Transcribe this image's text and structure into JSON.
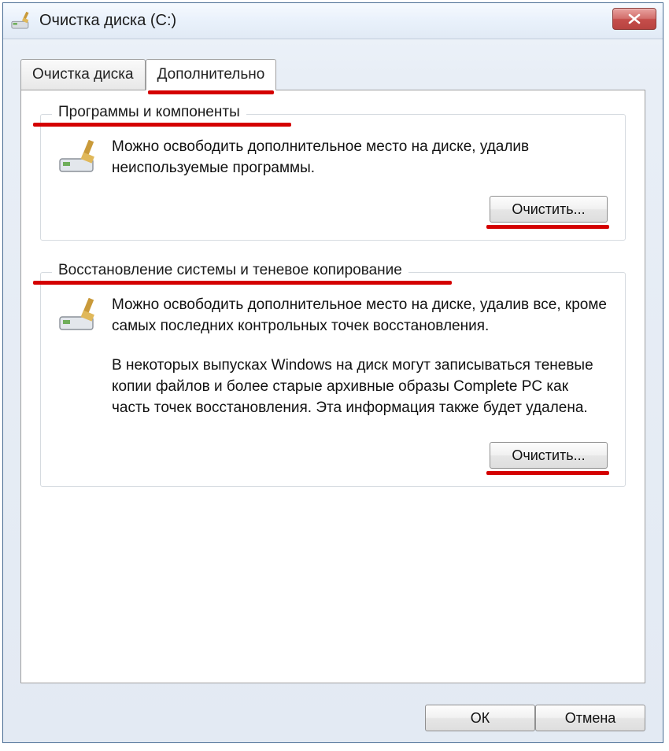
{
  "titlebar": {
    "title": "Очистка диска  (C:)"
  },
  "tabs": {
    "tab1": "Очистка диска",
    "tab2": "Дополнительно"
  },
  "group1": {
    "legend": "Программы и компоненты",
    "text": "Можно освободить дополнительное место на диске, удалив неиспользуемые программы.",
    "button": "Очистить..."
  },
  "group2": {
    "legend": "Восстановление системы и теневое копирование",
    "text1": "Можно освободить дополнительное место на диске, удалив все, кроме самых последних контрольных точек восстановления.",
    "text2": "В некоторых выпусках Windows на диск могут записываться теневые копии файлов и более старые архивные образы Complete PC как часть точек восстановления. Эта информация также будет удалена.",
    "button": "Очистить..."
  },
  "footer": {
    "ok": "ОК",
    "cancel": "Отмена"
  }
}
